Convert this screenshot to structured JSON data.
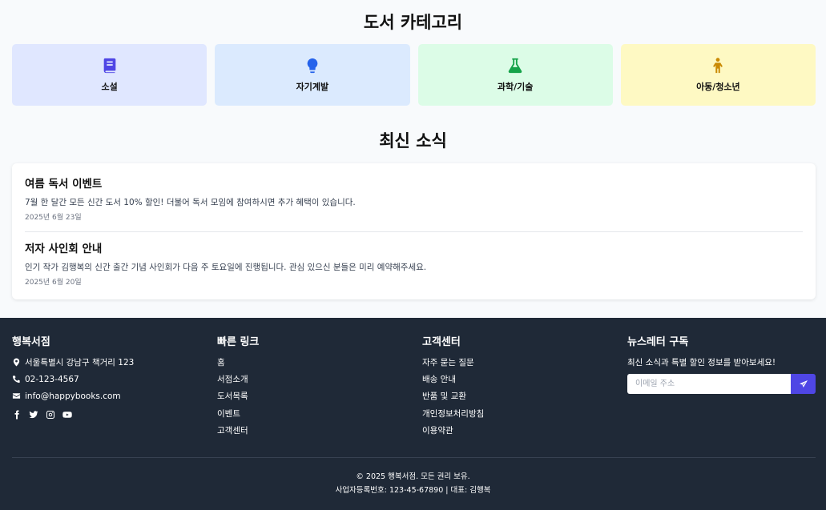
{
  "categories": {
    "title": "도서 카테고리",
    "items": [
      {
        "label": "소설",
        "icon": "book-icon",
        "bg": "#e0e7ff",
        "color": "#4f46e5"
      },
      {
        "label": "자기계발",
        "icon": "lightbulb-icon",
        "bg": "#dbeafe",
        "color": "#2563eb"
      },
      {
        "label": "과학/기술",
        "icon": "flask-icon",
        "bg": "#dcfce7",
        "color": "#16a34a"
      },
      {
        "label": "아동/청소년",
        "icon": "child-icon",
        "bg": "#fef9c3",
        "color": "#ca8a04"
      }
    ]
  },
  "news": {
    "title": "최신 소식",
    "items": [
      {
        "title": "여름 독서 이벤트",
        "body": "7월 한 달간 모든 신간 도서 10% 할인! 더불어 독서 모임에 참여하시면 추가 혜택이 있습니다.",
        "date": "2025년 6월 23일"
      },
      {
        "title": "저자 사인회 안내",
        "body": "인기 작가 김행복의 신간 출간 기념 사인회가 다음 주 토요일에 진행됩니다. 관심 있으신 분들은 미리 예약해주세요.",
        "date": "2025년 6월 20일"
      }
    ]
  },
  "footer": {
    "store": {
      "title": "행복서점",
      "address": "서울특별시 강남구 책거리 123",
      "phone": "02-123-4567",
      "email": "info@happybooks.com",
      "social": [
        "facebook-icon",
        "twitter-icon",
        "instagram-icon",
        "youtube-icon"
      ]
    },
    "quick_links": {
      "title": "빠른 링크",
      "items": [
        "홈",
        "서점소개",
        "도서목록",
        "이벤트",
        "고객센터"
      ]
    },
    "support": {
      "title": "고객센터",
      "items": [
        "자주 묻는 질문",
        "배송 안내",
        "반품 및 교환",
        "개인정보처리방침",
        "이용약관"
      ]
    },
    "newsletter": {
      "title": "뉴스레터 구독",
      "text": "최신 소식과 특별 할인 정보를 받아보세요!",
      "placeholder": "이메일 주소",
      "accent": "#4f46e5"
    },
    "copyright": "© 2025 행복서점. 모든 권리 보유.",
    "business": "사업자등록번호: 123-45-67890 | 대표: 김행복"
  }
}
